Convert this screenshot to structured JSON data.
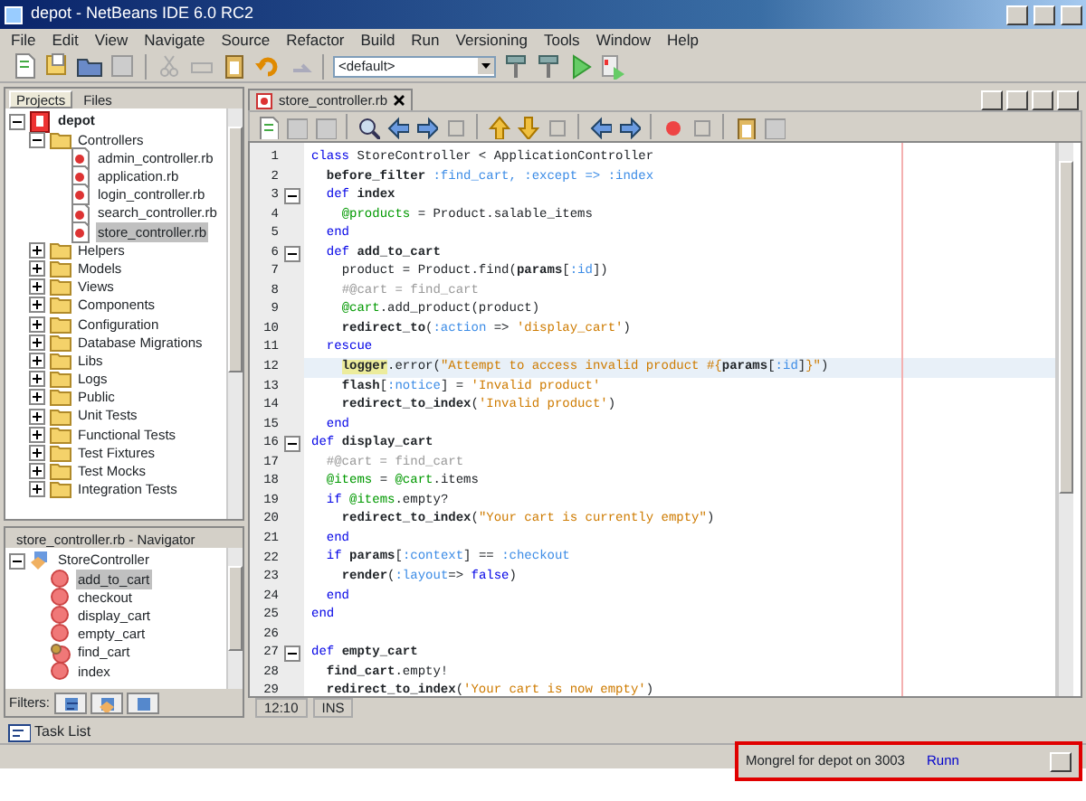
{
  "window": {
    "title": "depot - NetBeans IDE 6.0 RC2"
  },
  "menu": [
    "File",
    "Edit",
    "View",
    "Navigate",
    "Source",
    "Refactor",
    "Build",
    "Run",
    "Versioning",
    "Tools",
    "Window",
    "Help"
  ],
  "toolbar": {
    "configuration": "<default>"
  },
  "left_tabs": [
    {
      "label": "Projects",
      "selected": true
    },
    {
      "label": "Files",
      "selected": false
    }
  ],
  "project_tree": [
    {
      "label": "depot",
      "kind": "project",
      "expanded": true,
      "selected": false,
      "children": [
        {
          "label": "Controllers",
          "kind": "folder",
          "expanded": true,
          "selected": false,
          "children": [
            {
              "label": "admin_controller.rb",
              "kind": "file",
              "selected": false
            },
            {
              "label": "application.rb",
              "kind": "file",
              "selected": false
            },
            {
              "label": "login_controller.rb",
              "kind": "file",
              "selected": false
            },
            {
              "label": "search_controller.rb",
              "kind": "file",
              "selected": false
            },
            {
              "label": "store_controller.rb",
              "kind": "file",
              "selected": true
            }
          ]
        },
        {
          "label": "Helpers",
          "kind": "folder",
          "expanded": false,
          "selected": false
        },
        {
          "label": "Models",
          "kind": "folder",
          "expanded": false,
          "selected": false
        },
        {
          "label": "Views",
          "kind": "folder",
          "expanded": false,
          "selected": false
        },
        {
          "label": "Components",
          "kind": "folder",
          "expanded": false,
          "selected": false
        },
        {
          "label": "Configuration",
          "kind": "folder",
          "expanded": false,
          "selected": false
        },
        {
          "label": "Database Migrations",
          "kind": "folder",
          "expanded": false,
          "selected": false
        },
        {
          "label": "Libs",
          "kind": "folder",
          "expanded": false,
          "selected": false
        },
        {
          "label": "Logs",
          "kind": "folder",
          "expanded": false,
          "selected": false
        },
        {
          "label": "Public",
          "kind": "folder",
          "expanded": false,
          "selected": false
        },
        {
          "label": "Unit Tests",
          "kind": "folder",
          "expanded": false,
          "selected": false
        },
        {
          "label": "Functional Tests",
          "kind": "folder",
          "expanded": false,
          "selected": false
        },
        {
          "label": "Test Fixtures",
          "kind": "folder",
          "expanded": false,
          "selected": false
        },
        {
          "label": "Test Mocks",
          "kind": "folder",
          "expanded": false,
          "selected": false
        },
        {
          "label": "Integration Tests",
          "kind": "folder",
          "expanded": false,
          "selected": false
        }
      ]
    }
  ],
  "navigator": {
    "title": "store_controller.rb - Navigator",
    "tree": [
      {
        "label": "StoreController",
        "kind": "class",
        "expanded": true,
        "selected": false,
        "children": [
          {
            "label": "add_to_cart",
            "kind": "method",
            "selected": true
          },
          {
            "label": "checkout",
            "kind": "method",
            "selected": false
          },
          {
            "label": "display_cart",
            "kind": "method",
            "selected": false
          },
          {
            "label": "empty_cart",
            "kind": "method",
            "selected": false
          },
          {
            "label": "find_cart",
            "kind": "private-method",
            "selected": false
          },
          {
            "label": "index",
            "kind": "method",
            "selected": false
          }
        ]
      }
    ],
    "filters_label": "Filters:"
  },
  "editor": {
    "tab": "store_controller.rb",
    "lines": [
      {
        "n": "1",
        "fold": false,
        "highlighted": false,
        "segs": [
          {
            "kind": "kw",
            "t": "class"
          },
          {
            "kind": "plain",
            "t": " StoreController < ApplicationController"
          }
        ]
      },
      {
        "n": "2",
        "fold": false,
        "highlighted": false,
        "segs": [
          {
            "kind": "bold",
            "t": "  before_filter"
          },
          {
            "kind": "sym",
            "t": " :find_cart, :except => :index"
          }
        ]
      },
      {
        "n": "3",
        "fold": true,
        "highlighted": false,
        "segs": [
          {
            "kind": "kw",
            "t": "  def"
          },
          {
            "kind": "bold",
            "t": " index"
          }
        ]
      },
      {
        "n": "4",
        "fold": false,
        "highlighted": false,
        "segs": [
          {
            "kind": "ivar",
            "t": "    @products"
          },
          {
            "kind": "plain",
            "t": " = Product.salable_items"
          }
        ]
      },
      {
        "n": "5",
        "fold": false,
        "highlighted": false,
        "segs": [
          {
            "kind": "kw",
            "t": "  end"
          }
        ]
      },
      {
        "n": "6",
        "fold": true,
        "highlighted": false,
        "segs": [
          {
            "kind": "kw",
            "t": "  def"
          },
          {
            "kind": "bold",
            "t": " add_to_cart"
          }
        ]
      },
      {
        "n": "7",
        "fold": false,
        "highlighted": false,
        "segs": [
          {
            "kind": "plain",
            "t": "    product = Product.find("
          },
          {
            "kind": "bold",
            "t": "params"
          },
          {
            "kind": "plain",
            "t": "["
          },
          {
            "kind": "sym",
            "t": ":id"
          },
          {
            "kind": "plain",
            "t": "])"
          }
        ]
      },
      {
        "n": "8",
        "fold": false,
        "highlighted": false,
        "segs": [
          {
            "kind": "cmt",
            "t": "    #@cart = find_cart"
          }
        ]
      },
      {
        "n": "9",
        "fold": false,
        "highlighted": false,
        "segs": [
          {
            "kind": "ivar",
            "t": "    @cart"
          },
          {
            "kind": "plain",
            "t": ".add_product(product)"
          }
        ]
      },
      {
        "n": "10",
        "fold": false,
        "highlighted": false,
        "segs": [
          {
            "kind": "bold",
            "t": "    redirect_to"
          },
          {
            "kind": "plain",
            "t": "("
          },
          {
            "kind": "sym",
            "t": ":action"
          },
          {
            "kind": "plain",
            "t": " => "
          },
          {
            "kind": "str",
            "t": "'display_cart'"
          },
          {
            "kind": "plain",
            "t": ")"
          }
        ]
      },
      {
        "n": "11",
        "fold": false,
        "highlighted": false,
        "segs": [
          {
            "kind": "kw",
            "t": "  rescue"
          }
        ]
      },
      {
        "n": "12",
        "fold": false,
        "highlighted": true,
        "segs": [
          {
            "kind": "mark",
            "t": "    logger"
          },
          {
            "kind": "plain",
            "t": ".error("
          },
          {
            "kind": "str",
            "t": "\"Attempt to access invalid product #{"
          },
          {
            "kind": "bold",
            "t": "params"
          },
          {
            "kind": "plain",
            "t": "["
          },
          {
            "kind": "sym",
            "t": ":id"
          },
          {
            "kind": "plain",
            "t": "]"
          },
          {
            "kind": "str",
            "t": "}\""
          },
          {
            "kind": "plain",
            "t": ")"
          }
        ]
      },
      {
        "n": "13",
        "fold": false,
        "highlighted": false,
        "segs": [
          {
            "kind": "bold",
            "t": "    flash"
          },
          {
            "kind": "plain",
            "t": "["
          },
          {
            "kind": "sym",
            "t": ":notice"
          },
          {
            "kind": "plain",
            "t": "] = "
          },
          {
            "kind": "str",
            "t": "'Invalid product'"
          }
        ]
      },
      {
        "n": "14",
        "fold": false,
        "highlighted": false,
        "segs": [
          {
            "kind": "bold",
            "t": "    redirect_to_index"
          },
          {
            "kind": "plain",
            "t": "("
          },
          {
            "kind": "str",
            "t": "'Invalid product'"
          },
          {
            "kind": "plain",
            "t": ")"
          }
        ]
      },
      {
        "n": "15",
        "fold": false,
        "highlighted": false,
        "segs": [
          {
            "kind": "kw",
            "t": "  end"
          }
        ]
      },
      {
        "n": "16",
        "fold": true,
        "highlighted": false,
        "segs": [
          {
            "kind": "kw",
            "t": "def"
          },
          {
            "kind": "bold",
            "t": " display_cart"
          }
        ]
      },
      {
        "n": "17",
        "fold": false,
        "highlighted": false,
        "segs": [
          {
            "kind": "cmt",
            "t": "  #@cart = find_cart"
          }
        ]
      },
      {
        "n": "18",
        "fold": false,
        "highlighted": false,
        "segs": [
          {
            "kind": "ivar",
            "t": "  @items"
          },
          {
            "kind": "plain",
            "t": " = "
          },
          {
            "kind": "ivar",
            "t": "@cart"
          },
          {
            "kind": "plain",
            "t": ".items"
          }
        ]
      },
      {
        "n": "19",
        "fold": false,
        "highlighted": false,
        "segs": [
          {
            "kind": "kw",
            "t": "  if "
          },
          {
            "kind": "ivar",
            "t": "@items"
          },
          {
            "kind": "plain",
            "t": ".empty?"
          }
        ]
      },
      {
        "n": "20",
        "fold": false,
        "highlighted": false,
        "segs": [
          {
            "kind": "bold",
            "t": "    redirect_to_index"
          },
          {
            "kind": "plain",
            "t": "("
          },
          {
            "kind": "str",
            "t": "\"Your cart is currently empty\""
          },
          {
            "kind": "plain",
            "t": ")"
          }
        ]
      },
      {
        "n": "21",
        "fold": false,
        "highlighted": false,
        "segs": [
          {
            "kind": "kw",
            "t": "  end"
          }
        ]
      },
      {
        "n": "22",
        "fold": false,
        "highlighted": false,
        "segs": [
          {
            "kind": "kw",
            "t": "  if "
          },
          {
            "kind": "bold",
            "t": "params"
          },
          {
            "kind": "plain",
            "t": "["
          },
          {
            "kind": "sym",
            "t": ":context"
          },
          {
            "kind": "plain",
            "t": "] == "
          },
          {
            "kind": "sym",
            "t": ":checkout"
          }
        ]
      },
      {
        "n": "23",
        "fold": false,
        "highlighted": false,
        "segs": [
          {
            "kind": "bold",
            "t": "    render"
          },
          {
            "kind": "plain",
            "t": "("
          },
          {
            "kind": "sym",
            "t": ":layout"
          },
          {
            "kind": "plain",
            "t": "=> "
          },
          {
            "kind": "kw",
            "t": "false"
          },
          {
            "kind": "plain",
            "t": ")"
          }
        ]
      },
      {
        "n": "24",
        "fold": false,
        "highlighted": false,
        "segs": [
          {
            "kind": "kw",
            "t": "  end"
          }
        ]
      },
      {
        "n": "25",
        "fold": false,
        "highlighted": false,
        "segs": [
          {
            "kind": "kw",
            "t": "end"
          }
        ]
      },
      {
        "n": "26",
        "fold": false,
        "highlighted": false
      },
      {
        "n": "27",
        "fold": true,
        "highlighted": false,
        "segs": [
          {
            "kind": "kw",
            "t": "def"
          },
          {
            "kind": "bold",
            "t": " empty_cart"
          }
        ]
      },
      {
        "n": "28",
        "fold": false,
        "highlighted": false,
        "segs": [
          {
            "kind": "bold",
            "t": "  find_cart"
          },
          {
            "kind": "plain",
            "t": ".empty!"
          }
        ]
      },
      {
        "n": "29",
        "fold": false,
        "highlighted": false,
        "segs": [
          {
            "kind": "bold",
            "t": "  redirect_to_index"
          },
          {
            "kind": "plain",
            "t": "("
          },
          {
            "kind": "str",
            "t": "'Your cart is now empty'"
          },
          {
            "kind": "plain",
            "t": ")"
          }
        ]
      }
    ],
    "position": "12:10",
    "mode": "INS"
  },
  "task_list": "Task List",
  "status_bar": {
    "message": "Mongrel for depot on 3003",
    "action": "Runn"
  }
}
